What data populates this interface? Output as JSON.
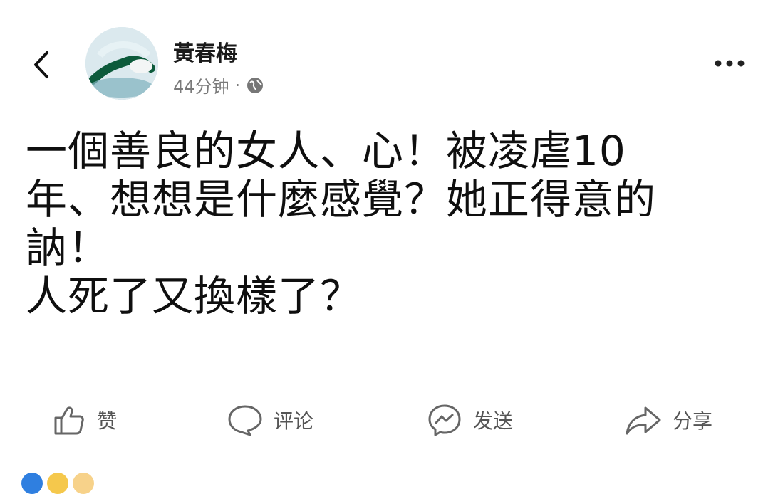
{
  "post": {
    "author": "黃春梅",
    "time": "44分钟",
    "separator": "·",
    "lines": [
      "一個善良的女人、心！被凌虐10",
      "年、想想是什麼感覺？她正得意的",
      "訥！",
      "人死了又換樣了？"
    ]
  },
  "actions": {
    "like": "赞",
    "comment": "评论",
    "send": "发送",
    "share": "分享"
  },
  "icons": {
    "back": "chevron-left-icon",
    "more": "more-dots-icon",
    "privacy": "globe-icon",
    "like": "thumbs-up-icon",
    "comment": "comment-bubble-icon",
    "send": "messenger-icon",
    "share": "share-arrow-icon"
  }
}
